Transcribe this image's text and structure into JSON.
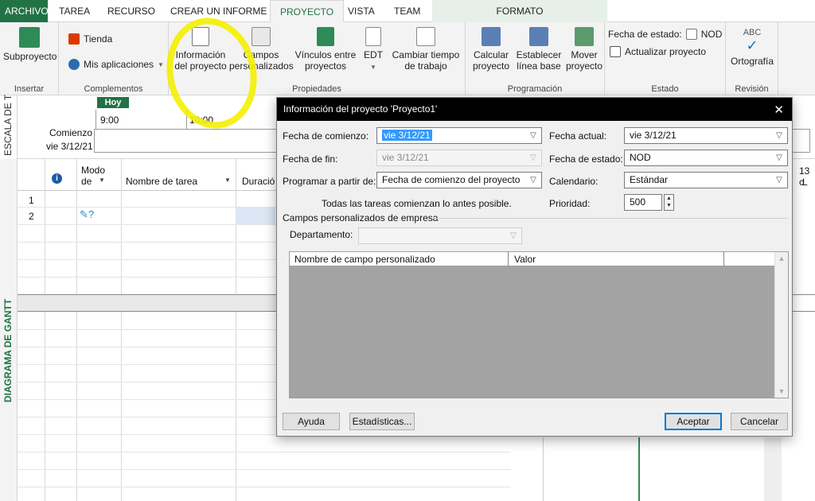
{
  "tabs": [
    {
      "label": "ARCHIVO"
    },
    {
      "label": "TAREA"
    },
    {
      "label": "RECURSO"
    },
    {
      "label": "CREAR UN INFORME"
    },
    {
      "label": "PROYECTO"
    },
    {
      "label": "VISTA"
    },
    {
      "label": "TEAM"
    }
  ],
  "context_tab": "FORMATO",
  "ribbon": {
    "insertar": {
      "label": "Insertar",
      "subproyecto": "Subproyecto"
    },
    "complementos": {
      "label": "Complementos",
      "tienda": "Tienda",
      "mis_apps": "Mis aplicaciones"
    },
    "propiedades": {
      "label": "Propiedades",
      "info_l1": "Información",
      "info_l2": "del proyecto",
      "campos_l1": "Campos",
      "campos_l2": "personalizados",
      "vinculos_l1": "Vínculos entre",
      "vinculos_l2": "proyectos",
      "edt": "EDT",
      "cambiar_l1": "Cambiar tiempo",
      "cambiar_l2": "de trabajo"
    },
    "programacion": {
      "label": "Programación",
      "calcular_l1": "Calcular",
      "calcular_l2": "proyecto",
      "establecer_l1": "Establecer",
      "establecer_l2": "línea base",
      "mover_l1": "Mover",
      "mover_l2": "proyecto"
    },
    "estado": {
      "label": "Estado",
      "fecha_estado": "Fecha de estado:",
      "fecha_estado_val": "NOD",
      "actualizar": "Actualizar proyecto"
    },
    "revision": {
      "label": "Revisión",
      "abc": "ABC",
      "ortografia": "Ortografía"
    }
  },
  "side": {
    "timescale": "ESCALA DE T",
    "gantt": "DIAGRAMA DE GANTT"
  },
  "timeline": {
    "today": "Hoy",
    "t1": "9:00",
    "t2": "10:00",
    "start_label": "Comienzo",
    "start_date": "vie 3/12/21"
  },
  "grid": {
    "col_modo_l1": "Modo",
    "col_modo_l2": "de",
    "col_nombre": "Nombre de tarea",
    "col_duracion": "Duració",
    "rows": [
      "1",
      "2"
    ],
    "chart_date": "13 c",
    "chart_day": "L"
  },
  "dialog": {
    "title": "Información del proyecto 'Proyecto1'",
    "fecha_comienzo_label": "Fecha de comienzo:",
    "fecha_comienzo": "vie 3/12/21",
    "fecha_fin_label": "Fecha de fin:",
    "fecha_fin": "vie 3/12/21",
    "programar_label": "Programar a partir de:",
    "programar": "Fecha de comienzo del proyecto",
    "nota": "Todas las tareas comienzan lo antes posible.",
    "fecha_actual_label": "Fecha actual:",
    "fecha_actual": "vie 3/12/21",
    "fecha_estado_label": "Fecha de estado:",
    "fecha_estado": "NOD",
    "calendario_label": "Calendario:",
    "calendario": "Estándar",
    "prioridad_label": "Prioridad:",
    "prioridad": "500",
    "campos_empresa": "Campos personalizados de empresa",
    "departamento_label": "Departamento:",
    "col_nombre_campo": "Nombre de campo personalizado",
    "col_valor": "Valor",
    "ayuda": "Ayuda",
    "estadisticas": "Estadísticas...",
    "aceptar": "Aceptar",
    "cancelar": "Cancelar"
  },
  "colors": {
    "brand": "#217346",
    "highlight": "#f4f000"
  }
}
